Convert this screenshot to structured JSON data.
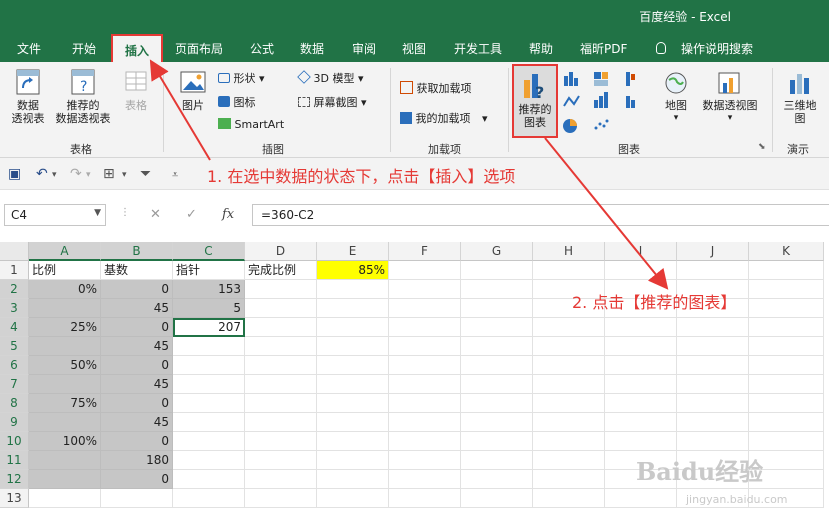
{
  "window": {
    "title": "百度经验  -  Excel"
  },
  "menu": {
    "tabs": [
      "文件",
      "开始",
      "插入",
      "页面布局",
      "公式",
      "数据",
      "审阅",
      "视图",
      "开发工具",
      "帮助",
      "福昕PDF"
    ],
    "active_tab": "插入",
    "tell_me": "操作说明搜索"
  },
  "ribbon": {
    "tables": {
      "pivot": "数据\n透视表",
      "recommended_pivot": "推荐的\n数据透视表",
      "table": "表格",
      "group": "表格"
    },
    "illustrations": {
      "picture": "图片",
      "shapes": "形状",
      "icons": "图标",
      "model3d": "3D 模型",
      "smartart": "SmartArt",
      "screenshot": "屏幕截图",
      "group": "插图"
    },
    "addins": {
      "get": "获取加载项",
      "mine": "我的加载项",
      "group": "加载项"
    },
    "charts": {
      "recommended": "推荐的\n图表",
      "maps": "地图",
      "pivot_chart": "数据透视图",
      "group": "图表"
    },
    "tours": {
      "map3d": "三维地\n图",
      "group": "演示"
    }
  },
  "annotations": {
    "step1": "1. 在选中数据的状态下，点击【插入】选项",
    "step2": "2. 点击【推荐的图表】"
  },
  "formula_bar": {
    "name_box": "C4",
    "formula": "=360-C2",
    "fx": "fx"
  },
  "grid": {
    "columns": [
      "A",
      "B",
      "C",
      "D",
      "E",
      "F",
      "G",
      "H",
      "I",
      "J",
      "K"
    ],
    "rows": [
      "1",
      "2",
      "3",
      "4",
      "5",
      "6",
      "7",
      "8",
      "9",
      "10",
      "11",
      "12",
      "13"
    ],
    "cells": {
      "A1": "比例",
      "B1": "基数",
      "C1": "指针",
      "D1": "完成比例",
      "E1": "85%",
      "A2": "0%",
      "B2": "0",
      "C2": "153",
      "B3": "45",
      "C3": "5",
      "A4": "25%",
      "B4": "0",
      "C4": "207",
      "B5": "45",
      "A6": "50%",
      "B6": "0",
      "B7": "45",
      "A8": "75%",
      "B8": "0",
      "B9": "45",
      "A10": "100%",
      "B10": "0",
      "B11": "180",
      "B12": "0"
    }
  },
  "colors": {
    "accent": "#217346",
    "highlight": "#e53935",
    "yellow": "#ffff00"
  },
  "watermark": {
    "logo": "Baidu经验",
    "url": "jingyan.baidu.com"
  }
}
